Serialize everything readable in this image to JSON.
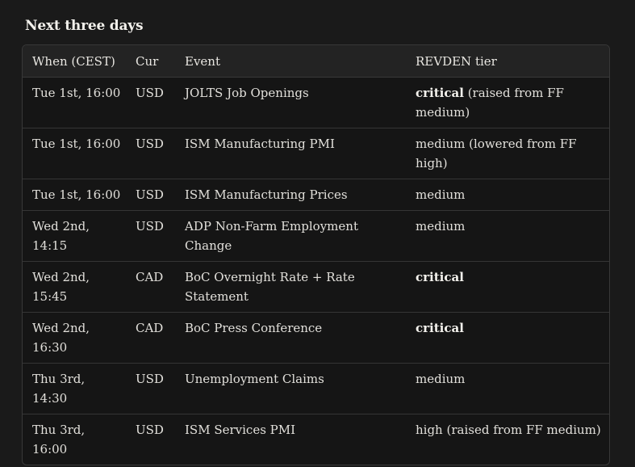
{
  "title": "Next three days",
  "columns": {
    "when": "When (CEST)",
    "cur": "Cur",
    "event": "Event",
    "tier": "REVDEN tier"
  },
  "rows": [
    {
      "when": "Tue 1st, 16:00",
      "cur": "USD",
      "event": "JOLTS Job Openings",
      "tier": "critical",
      "tier_note": " (raised from FF medium)"
    },
    {
      "when": "Tue 1st, 16:00",
      "cur": "USD",
      "event": "ISM Manufacturing PMI",
      "tier": "",
      "tier_note": "medium (lowered from FF high)"
    },
    {
      "when": "Tue 1st, 16:00",
      "cur": "USD",
      "event": "ISM Manufacturing Prices",
      "tier": "",
      "tier_note": "medium"
    },
    {
      "when": "Wed 2nd, 14:15",
      "cur": "USD",
      "event": "ADP Non-Farm Employment Change",
      "tier": "",
      "tier_note": "medium"
    },
    {
      "when": "Wed 2nd, 15:45",
      "cur": "CAD",
      "event": "BoC Overnight Rate + Rate Statement",
      "tier": "critical",
      "tier_note": ""
    },
    {
      "when": "Wed 2nd, 16:30",
      "cur": "CAD",
      "event": "BoC Press Conference",
      "tier": "critical",
      "tier_note": ""
    },
    {
      "when": "Thu 3rd, 14:30",
      "cur": "USD",
      "event": "Unemployment Claims",
      "tier": "",
      "tier_note": "medium"
    },
    {
      "when": "Thu 3rd, 16:00",
      "cur": "USD",
      "event": "ISM Services PMI",
      "tier": "",
      "tier_note": "high (raised from FF medium)"
    }
  ]
}
